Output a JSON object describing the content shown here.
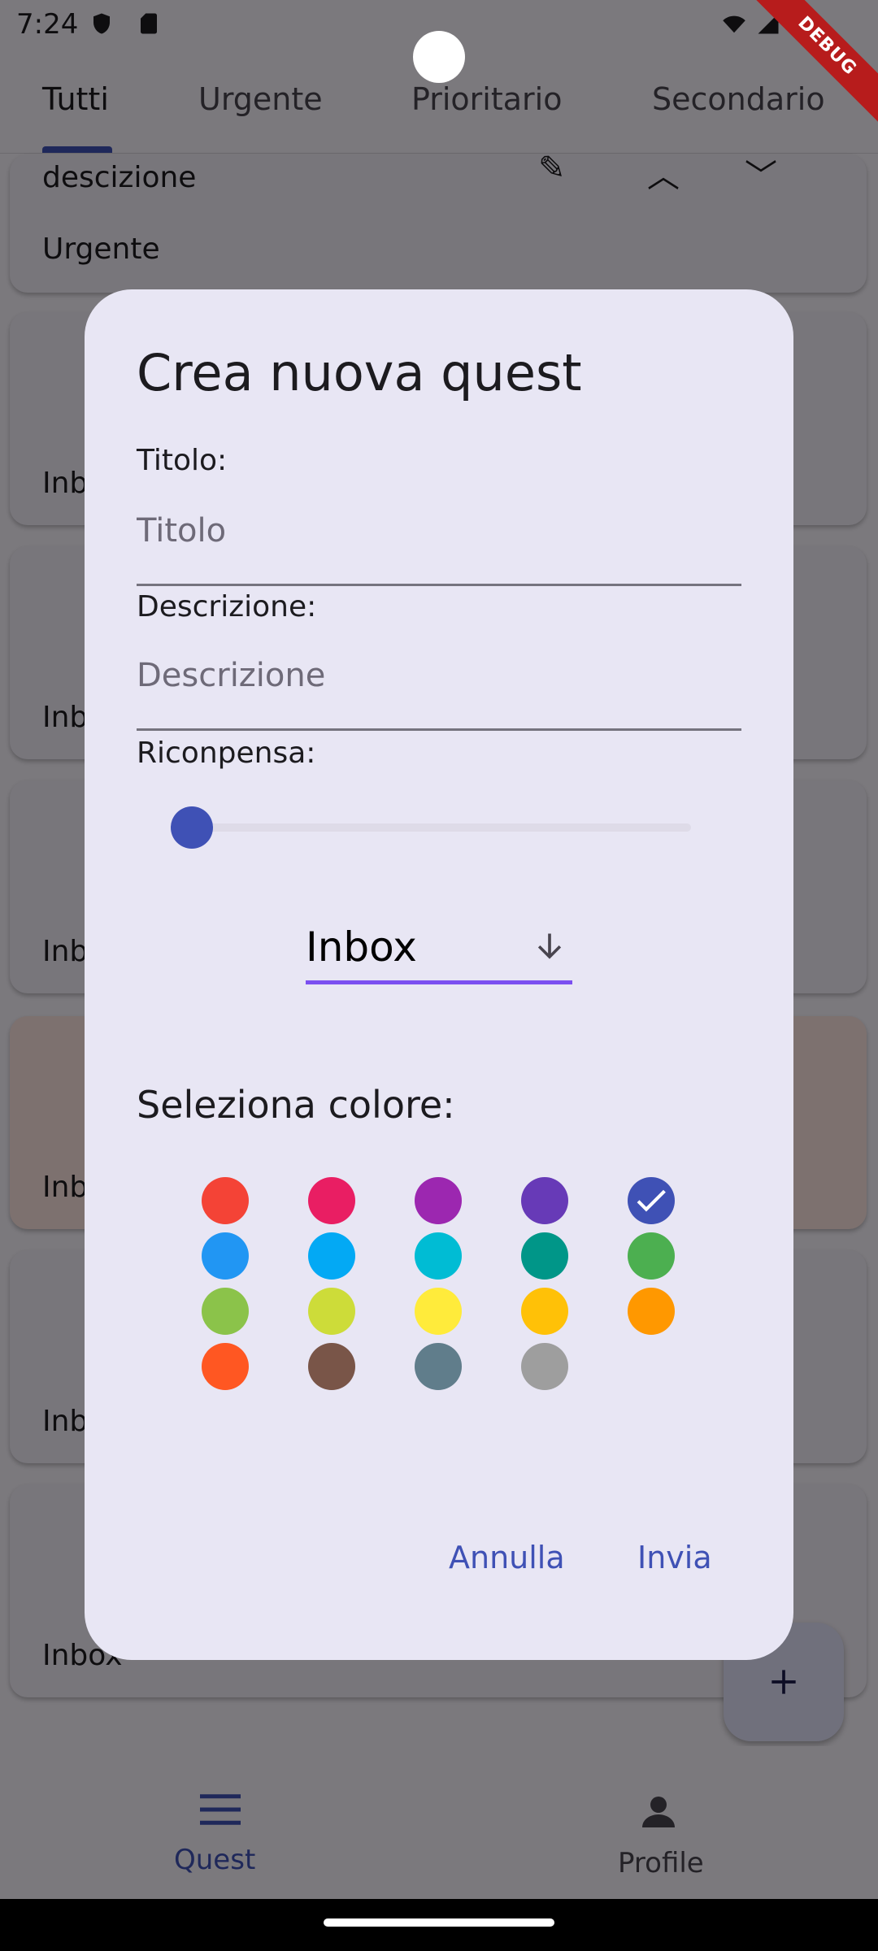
{
  "status_bar": {
    "time": "7:24"
  },
  "debug_ribbon": "DEBUG",
  "tabs": [
    {
      "label": "Tutti"
    },
    {
      "label": "Urgente"
    },
    {
      "label": "Prioritario"
    },
    {
      "label": "Secondario"
    }
  ],
  "cards": [
    {
      "description": "descizione",
      "category": "Urgente"
    },
    {
      "category": "Inbox"
    },
    {
      "category": "Inbox"
    },
    {
      "category": "Inbox"
    },
    {
      "category": "Inbox"
    },
    {
      "category": "Inbox"
    },
    {
      "category": "Inbox"
    }
  ],
  "dialog": {
    "title": "Crea nuova quest",
    "title_label": "Titolo:",
    "title_placeholder": "Titolo",
    "description_label": "Descrizione:",
    "description_placeholder": "Descrizione",
    "reward_label": "Riconpensa:",
    "reward_value": 0,
    "category_selected": "Inbox",
    "color_section_title": "Seleziona colore:",
    "colors": [
      "#f44336",
      "#e91e63",
      "#9c27b0",
      "#673ab7",
      "#3f51b5",
      "#2196f3",
      "#03a9f4",
      "#00bcd4",
      "#009688",
      "#4caf50",
      "#8bc34a",
      "#cddc39",
      "#ffeb3b",
      "#ffc107",
      "#ff9800",
      "#ff5722",
      "#795548",
      "#607d8b",
      "#9e9e9e"
    ],
    "selected_color": "#3f51b5",
    "cancel_label": "Annulla",
    "submit_label": "Invia"
  },
  "bottom_nav": [
    {
      "label": "Quest",
      "icon": "menu-icon",
      "active": true
    },
    {
      "label": "Profile",
      "icon": "person-icon",
      "active": false
    }
  ],
  "fab": {
    "icon": "plus-icon"
  }
}
